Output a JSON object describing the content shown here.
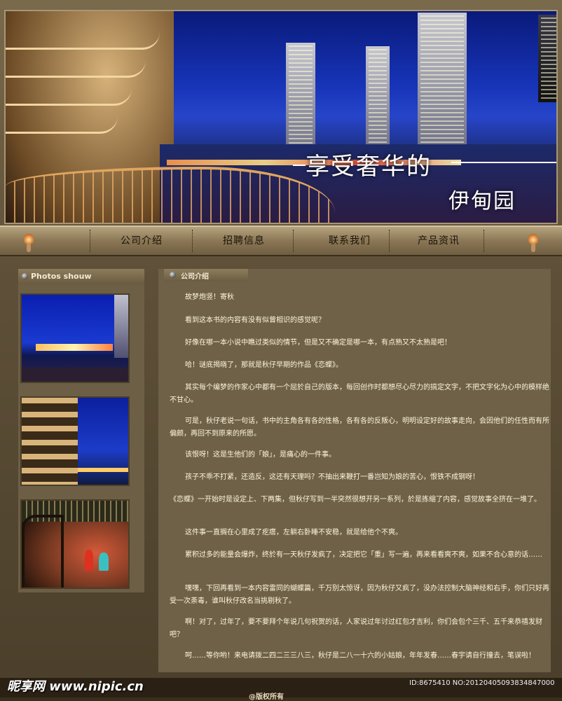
{
  "banner": {
    "slogan_line1": "享受奢华的",
    "slogan_line2": "伊甸园"
  },
  "nav": {
    "items": [
      {
        "label": "公司介绍"
      },
      {
        "label": "招聘信息"
      },
      {
        "label": "联系我们"
      },
      {
        "label": "产品资讯"
      }
    ]
  },
  "sidebar": {
    "title": "Photos shouw",
    "photos": [
      "city-night-skyline",
      "hotel-balcony-night",
      "terrace-cocktails"
    ]
  },
  "main": {
    "title": "公司介绍",
    "paragraphs": [
      "故梦炮竖！寄秋",
      "看到这本书的内容有没有似曾相识的感觉呢？",
      "好像在哪一本小说中瞧过类似的情节，但是又不确定是哪一本，有点熟又不太熟是吧！",
      "哈！谜底揭晓了，那就是秋仔早期的作品《恋蝶》。",
      "其实每个编梦的作家心中都有一个屈於自己的版本，每回创作时都想尽心尽力的搞定文字，不把文字化为心中的模样绝不甘心。",
      "可是，秋仔老说一句话，书中的主角各有各的性格，各有各的反叛心，明明设定好的故事走向，会因他们的任性而有所偏颇，再回不到原来的所愿。",
      "该恨呀！这是生他们的「娘」，是痛心的一件事。",
      "孩子不乖不打紧，还造反，这还有天理吗？不抽出来鞭打一番岂知为娘的苦心，恨铁不成钢呀！",
      "《恋蝶》一开始时是设定上、下两集，但秋仔写到一半突然很想开另一系列，於是拣缩了内容，感觉故事全挤在一堆了。",
      "这件事一直搁在心里成了疙瘩，左躺右卧睡不安稳，就是给他个不爽。",
      "累积过多的能量会爆炸，终於有一天秋仔发疯了，决定把它「重」写一遍，再来看看爽不爽，如果不合心意的话……",
      "嘿嘿，下回再看到一本内容雷同的蝴蝶篇，千万别太惊讶，因为秋仔又疯了，没办法控制大脑神经和右手，你们只好再受一次荼毒，谁叫秋仔改名当挑剔秋了。",
      "啊！对了，过年了，要不要拜个年说几句祝贺的话，人家说过年讨过红包才吉利，你们会包个三千、五千来恭禧发财吧？",
      "呵……等你哟！来电请拨二四二三三八三，秋仔是二八一十六的小姑娘，年年发春……春宇请自行撞去，笔误啦！"
    ]
  },
  "footer": {
    "copyright": "@版权所有",
    "watermark_left": "昵享网 www.nipic.cn",
    "watermark_right": "ID:8675410 NO:20120405093834847000"
  },
  "colors": {
    "nav_bg": "#8b7755",
    "panel_bg": "#6e6148",
    "text": "#fff6de"
  }
}
